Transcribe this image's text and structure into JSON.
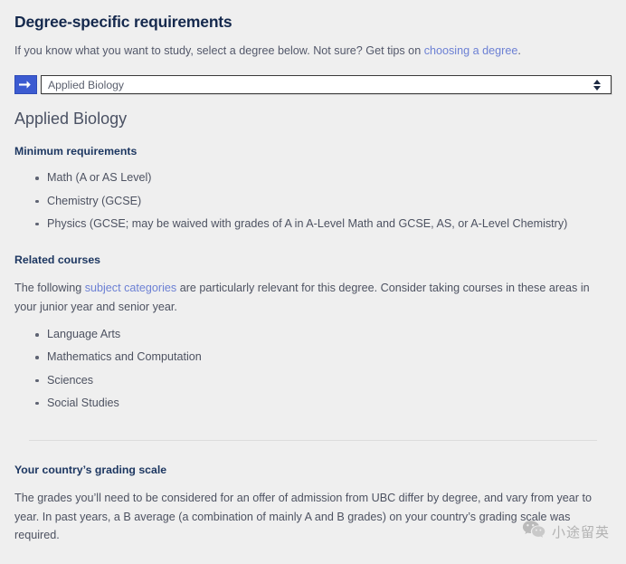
{
  "header": {
    "title": "Degree-specific requirements",
    "intro_before_link": "If you know what you want to study, select a degree below. Not sure? Get tips on ",
    "intro_link": "choosing a degree",
    "intro_after_link": "."
  },
  "degree_selector": {
    "go_button_icon": "arrow-right-icon",
    "selected_value": "Applied Biology",
    "spinner_up_icon": "triangle-up-icon",
    "spinner_down_icon": "triangle-down-icon"
  },
  "degree": {
    "name": "Applied Biology",
    "minimum_requirements": {
      "heading": "Minimum requirements",
      "items": [
        "Math (A or AS Level)",
        "Chemistry (GCSE)",
        "Physics (GCSE; may be waived with grades of A in A-Level Math and GCSE, AS, or A-Level Chemistry)"
      ]
    },
    "related_courses": {
      "heading": "Related courses",
      "para_before_link": "The following ",
      "para_link": "subject categories",
      "para_after_link": " are particularly relevant for this degree. Consider taking courses in these areas in your junior year and senior year.",
      "items": [
        "Language Arts",
        "Mathematics and Computation",
        "Sciences",
        "Social Studies"
      ]
    },
    "grading_scale": {
      "heading": "Your country’s grading scale",
      "paragraph": "The grades you’ll need to be considered for an offer of admission from UBC differ by degree, and vary from year to year. In past years, a B average (a combination of mainly A and B grades) on your country’s grading scale was required."
    }
  },
  "watermark": {
    "icon": "wechat-icon",
    "text": "小途留英"
  },
  "colors": {
    "page_background": "#efefef",
    "title_navy": "#15294d",
    "section_heading_blue": "#1d3761",
    "body_text": "#4d5261",
    "link_blue": "#6c80d4",
    "button_blue": "#3c5bd1",
    "divider": "#dcdcdc"
  }
}
